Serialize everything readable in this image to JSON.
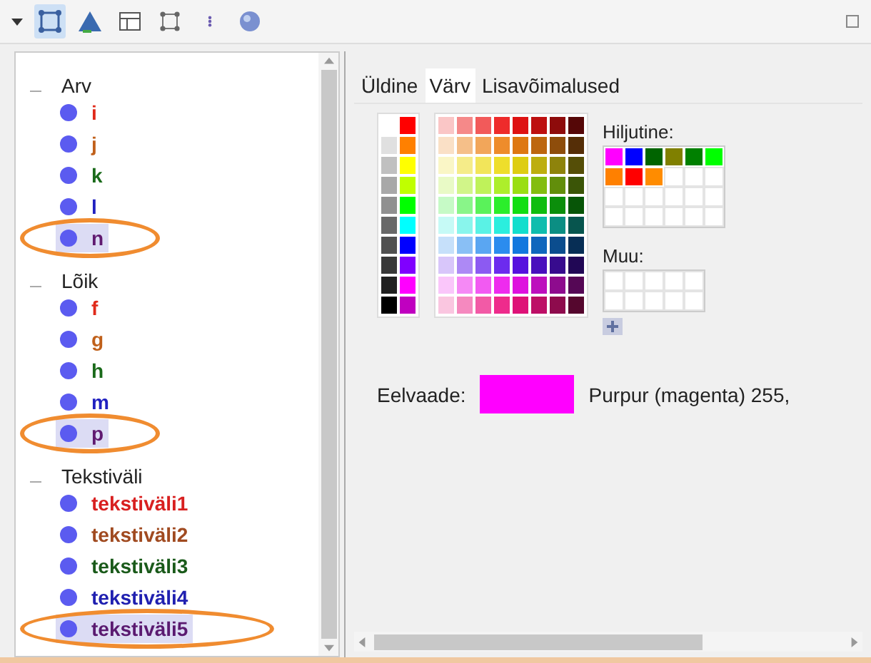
{
  "toolbar": {
    "tools": [
      {
        "kind": "square",
        "selected": true
      },
      {
        "kind": "triangle",
        "selected": false
      },
      {
        "kind": "table",
        "selected": false
      },
      {
        "kind": "points",
        "selected": false
      },
      {
        "kind": "dots",
        "selected": false
      },
      {
        "kind": "ball",
        "selected": false
      }
    ]
  },
  "tree": [
    {
      "label": "Arv",
      "expanded": true,
      "children": [
        {
          "label": "i",
          "color": "#e02a1a",
          "selected": false
        },
        {
          "label": "j",
          "color": "#c0601a",
          "selected": false
        },
        {
          "label": "k",
          "color": "#1a6a1a",
          "selected": false
        },
        {
          "label": "l",
          "color": "#2020c0",
          "selected": false
        },
        {
          "label": "n",
          "color": "#601a70",
          "selected": true
        }
      ]
    },
    {
      "label": "Lõik",
      "expanded": true,
      "children": [
        {
          "label": "f",
          "color": "#e02a1a",
          "selected": false
        },
        {
          "label": "g",
          "color": "#c0601a",
          "selected": false
        },
        {
          "label": "h",
          "color": "#1a6a1a",
          "selected": false
        },
        {
          "label": "m",
          "color": "#2020c0",
          "selected": false
        },
        {
          "label": "p",
          "color": "#601a70",
          "selected": true
        }
      ]
    },
    {
      "label": "Tekstiväli",
      "expanded": true,
      "children": [
        {
          "label": "tekstiväli1",
          "color": "#d82020",
          "selected": false
        },
        {
          "label": "tekstiväli2",
          "color": "#a04a20",
          "selected": false
        },
        {
          "label": "tekstiväli3",
          "color": "#1a5a1a",
          "selected": false
        },
        {
          "label": "tekstiväli4",
          "color": "#2020b0",
          "selected": false
        },
        {
          "label": "tekstiväli5",
          "color": "#5a1a70",
          "selected": true
        }
      ]
    }
  ],
  "tabs": [
    {
      "label": "Üldine",
      "selected": false
    },
    {
      "label": "Värv",
      "selected": true
    },
    {
      "label": "Lisavõimalused",
      "selected": false
    }
  ],
  "recent": {
    "label": "Hiljutine:",
    "colors": [
      {
        "color": "#ff00ff"
      },
      {
        "color": "#0000ff"
      },
      {
        "color": "#006400"
      },
      {
        "color": "#808000"
      },
      {
        "color": "#008000"
      },
      {
        "color": "#00ff00"
      },
      {
        "color": "#ff8000"
      },
      {
        "color": "#ff0000"
      },
      {
        "color": "#ff8c00"
      }
    ]
  },
  "custom": {
    "label": "Muu:"
  },
  "preview": {
    "label": "Eelvaade:",
    "color": "#ff00ff",
    "description": "Purpur (magenta) 255,"
  }
}
